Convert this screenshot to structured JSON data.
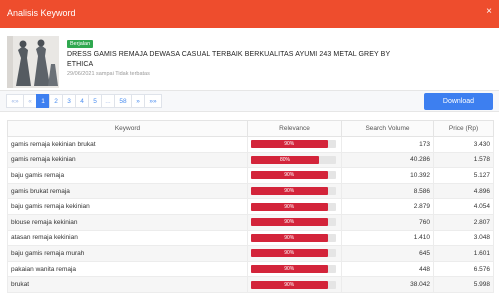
{
  "header": {
    "title": "Analisis Keyword",
    "close_label": "×"
  },
  "product": {
    "badge": "Berjalan",
    "name": "DRESS GAMIS REMAJA DEWASA CASUAL TERBAIK BERKUALITAS AYUMI 243 METAL GREY BY ETHICA",
    "date_range": "29/06/2021 sampai Tidak terbatas"
  },
  "pagination": {
    "first": "«»",
    "prev": "«",
    "pages": [
      "1",
      "2",
      "3",
      "4",
      "5",
      "...",
      "58"
    ],
    "active_page": "1",
    "next": "»",
    "last": "»»"
  },
  "download_label": "Download",
  "table": {
    "columns": [
      "Keyword",
      "Relevance",
      "Search Volume",
      "Price (Rp)"
    ],
    "rows": [
      {
        "keyword": "gamis remaja kekinian brukat",
        "relevance": "90%",
        "relevance_value": 0.9,
        "volume": "173",
        "price": "3.430"
      },
      {
        "keyword": "gamis remaja kekinian",
        "relevance": "80%",
        "relevance_value": 0.8,
        "volume": "40.286",
        "price": "1.578"
      },
      {
        "keyword": "baju gamis remaja",
        "relevance": "90%",
        "relevance_value": 0.9,
        "volume": "10.392",
        "price": "5.127"
      },
      {
        "keyword": "gamis brukat remaja",
        "relevance": "90%",
        "relevance_value": 0.9,
        "volume": "8.586",
        "price": "4.896"
      },
      {
        "keyword": "baju gamis remaja kekinian",
        "relevance": "90%",
        "relevance_value": 0.9,
        "volume": "2.879",
        "price": "4.054"
      },
      {
        "keyword": "blouse remaja kekinian",
        "relevance": "90%",
        "relevance_value": 0.9,
        "volume": "760",
        "price": "2.807"
      },
      {
        "keyword": "atasan remaja kekinian",
        "relevance": "90%",
        "relevance_value": 0.9,
        "volume": "1.410",
        "price": "3.048"
      },
      {
        "keyword": "baju gamis remaja murah",
        "relevance": "90%",
        "relevance_value": 0.9,
        "volume": "645",
        "price": "1.601"
      },
      {
        "keyword": "pakaian wanita remaja",
        "relevance": "90%",
        "relevance_value": 0.9,
        "volume": "448",
        "price": "6.576"
      },
      {
        "keyword": "brukat",
        "relevance": "90%",
        "relevance_value": 0.9,
        "volume": "38.042",
        "price": "5.998"
      }
    ]
  },
  "colors": {
    "header": "#ee4d2d",
    "accent": "#3d7ff0",
    "relevance_bar": "#d3243a",
    "badge": "#2fa84f"
  }
}
